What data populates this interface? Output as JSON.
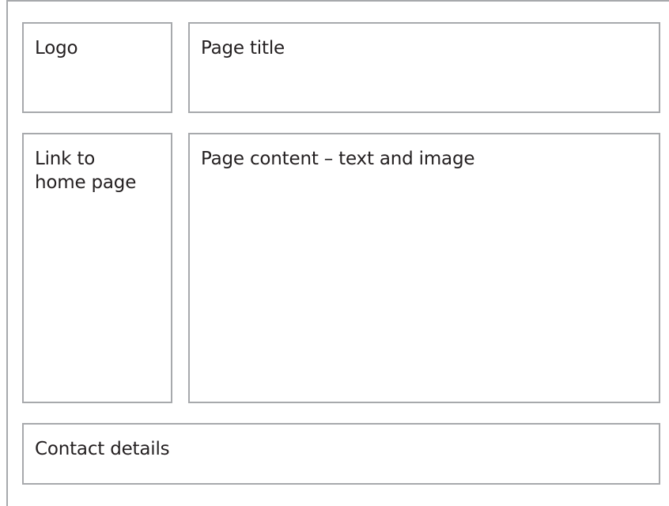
{
  "wireframe": {
    "logo_label": "Logo",
    "title_label": "Page title",
    "nav_label_line1": "Link to",
    "nav_label_line2": "home page",
    "content_label": "Page content – text and image",
    "footer_label": "Contact details"
  },
  "colors": {
    "border": "#a7a9ac",
    "text": "#231f20",
    "background": "#ffffff"
  }
}
